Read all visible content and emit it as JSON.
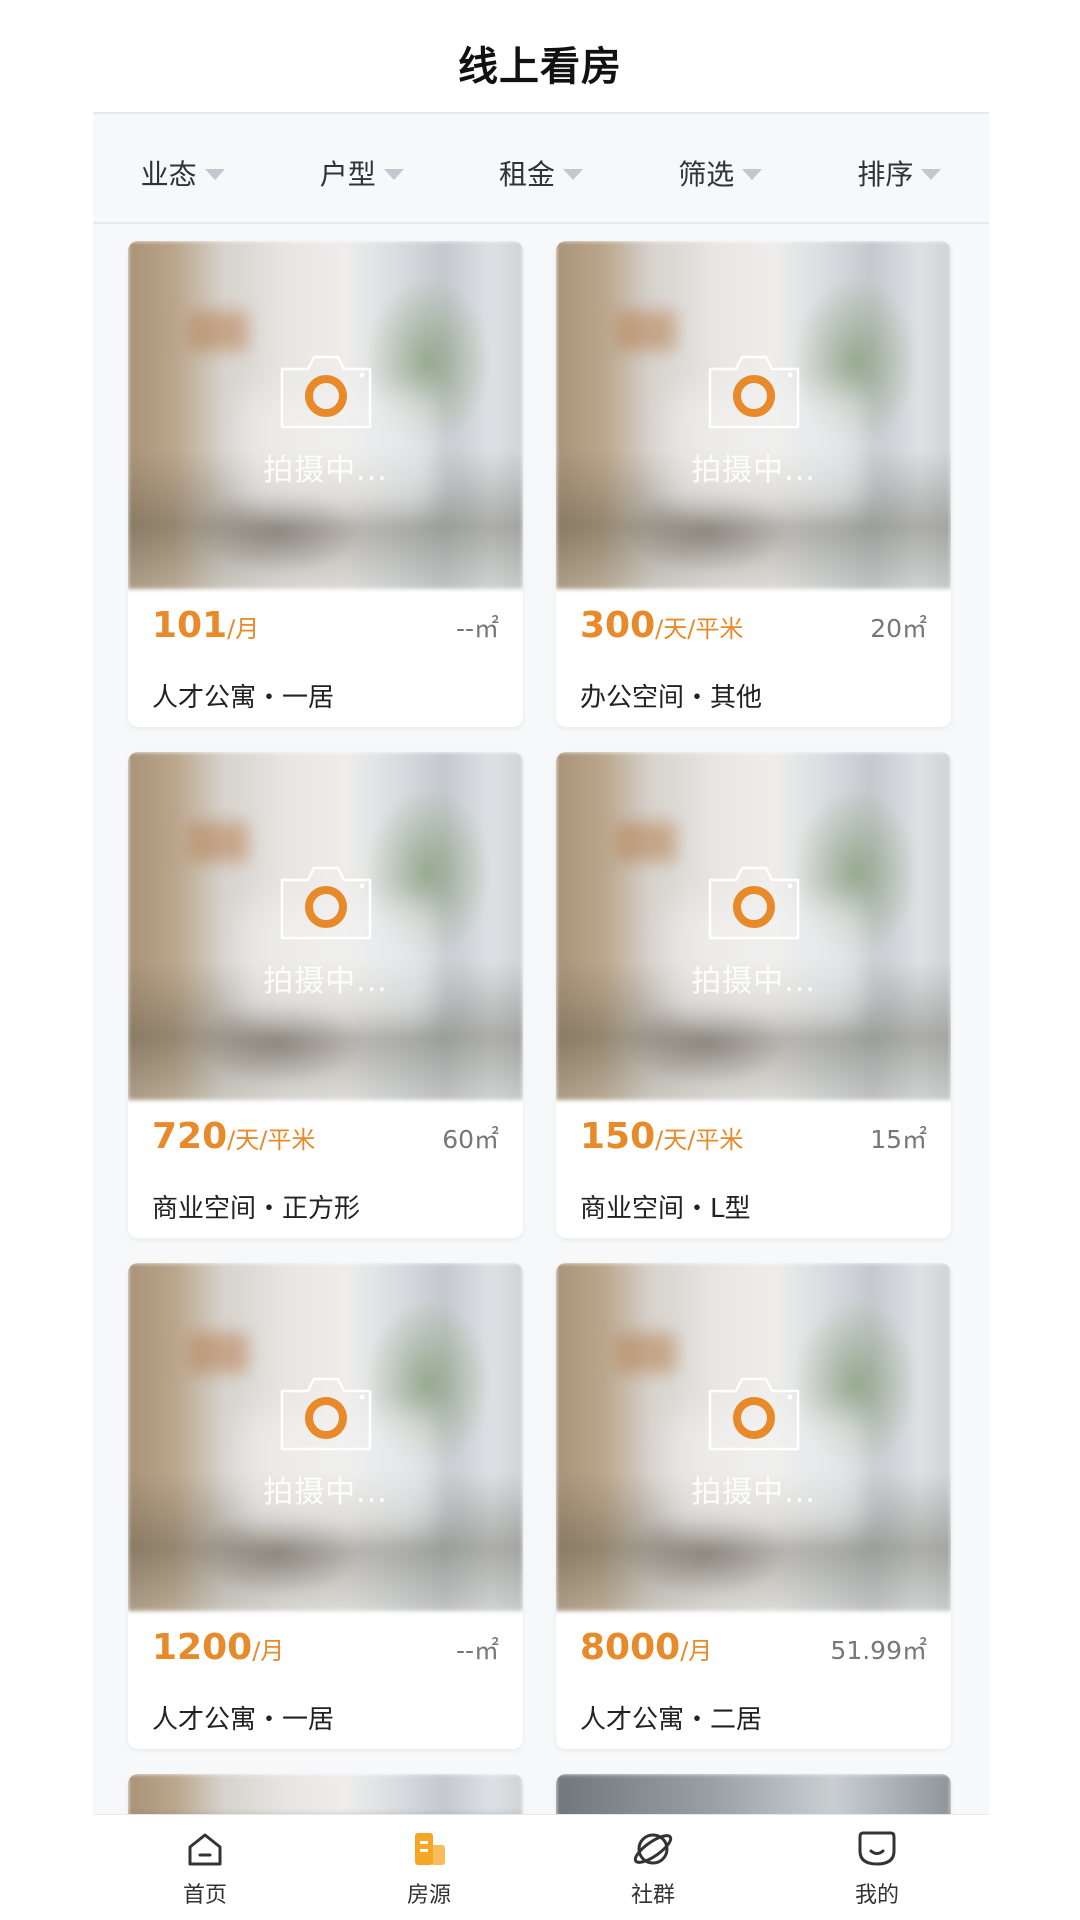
{
  "header": {
    "title": "线上看房"
  },
  "filters": [
    {
      "label": "业态"
    },
    {
      "label": "户型"
    },
    {
      "label": "租金"
    },
    {
      "label": "筛选"
    },
    {
      "label": "排序"
    }
  ],
  "photo_placeholder_text": "拍摄中...",
  "listings": [
    {
      "price": "101",
      "unit": "/月",
      "area": "--㎡",
      "desc": "人才公寓・一居"
    },
    {
      "price": "300",
      "unit": "/天/平米",
      "area": "20㎡",
      "desc": "办公空间・其他"
    },
    {
      "price": "720",
      "unit": "/天/平米",
      "area": "60㎡",
      "desc": "商业空间・正方形"
    },
    {
      "price": "150",
      "unit": "/天/平米",
      "area": "15㎡",
      "desc": "商业空间・L型"
    },
    {
      "price": "1200",
      "unit": "/月",
      "area": "--㎡",
      "desc": "人才公寓・一居"
    },
    {
      "price": "8000",
      "unit": "/月",
      "area": "51.99㎡",
      "desc": "人才公寓・二居"
    }
  ],
  "bottom_nav": [
    {
      "label": "首页",
      "icon": "home-icon"
    },
    {
      "label": "房源",
      "icon": "building-icon"
    },
    {
      "label": "社群",
      "icon": "planet-icon"
    },
    {
      "label": "我的",
      "icon": "user-icon"
    }
  ],
  "colors": {
    "accent": "#e8892a",
    "active_nav": "#f5a623"
  }
}
